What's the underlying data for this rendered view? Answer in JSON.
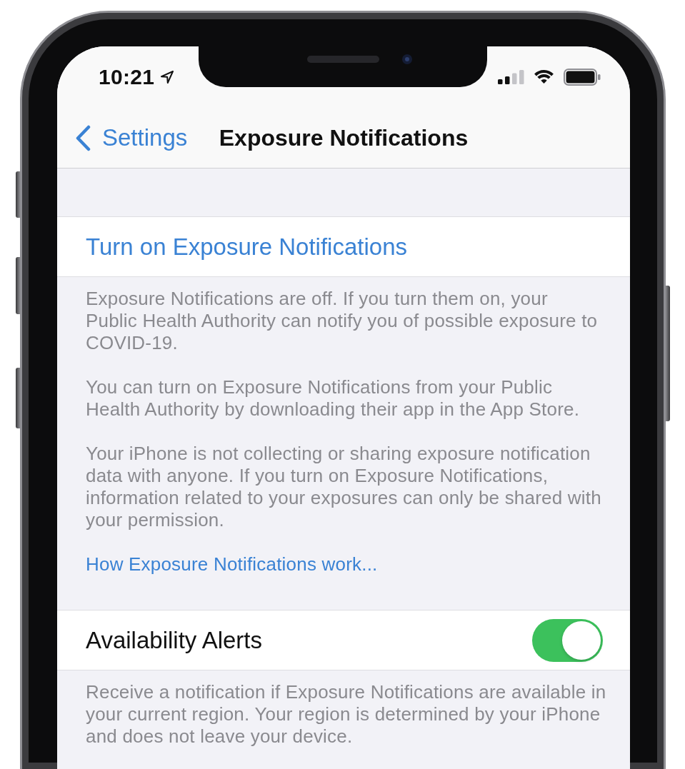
{
  "status_bar": {
    "time": "10:21"
  },
  "nav_bar": {
    "back_label": "Settings",
    "title": "Exposure Notifications"
  },
  "sections": [
    {
      "kind": "action",
      "label": "Turn on Exposure Notifications",
      "footer": [
        {
          "kind": "text",
          "text": "Exposure Notifications are off. If you turn them on, your Public Health Authority can notify you of possible exposure to COVID-19."
        },
        {
          "kind": "text",
          "text": "You can turn on Exposure Notifications from your Public Health Authority by downloading their app in the App Store."
        },
        {
          "kind": "text",
          "text": "Your iPhone is not collecting or sharing exposure notification data with anyone. If you turn on Exposure Notifications, information related to your exposures can only be shared with your permission."
        },
        {
          "kind": "link",
          "text": "How Exposure Notifications work..."
        }
      ]
    },
    {
      "kind": "toggle",
      "label": "Availability Alerts",
      "on": true,
      "footer": [
        {
          "kind": "text",
          "text": "Receive a notification if Exposure Notifications are available in your current region. Your region is determined by your iPhone and does not leave your device."
        }
      ]
    }
  ]
}
